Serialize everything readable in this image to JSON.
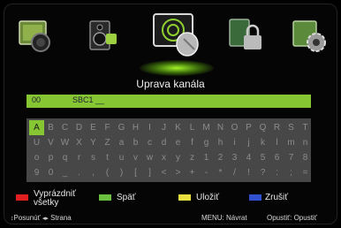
{
  "icons": [
    "picture-icon",
    "sound-icon",
    "channel-icon",
    "lock-icon",
    "setup-icon"
  ],
  "selected_icon": "channel-icon",
  "title": "Uprava kanála",
  "channel": {
    "number": "00",
    "name": "SBC1 __"
  },
  "keyboard": {
    "rows": [
      [
        "A",
        "B",
        "C",
        "D",
        "E",
        "F",
        "G",
        "H",
        "I",
        "J",
        "K",
        "L",
        "M",
        "N",
        "O",
        "P",
        "Q",
        "R",
        "S",
        "T"
      ],
      [
        "U",
        "V",
        "W",
        "X",
        "Y",
        "Z",
        "a",
        "b",
        "c",
        "d",
        "e",
        "f",
        "g",
        "h",
        "i",
        "j",
        "k",
        "l",
        "m",
        "n"
      ],
      [
        "o",
        "p",
        "q",
        "r",
        "s",
        "t",
        "u",
        "v",
        "w",
        "x",
        "y",
        "z",
        "1",
        "2",
        "3",
        "4",
        "5",
        "6",
        "7",
        "8"
      ],
      [
        "9",
        "0",
        "_",
        ".",
        ",",
        "(",
        ")",
        "[",
        "]",
        "<",
        ">",
        "+",
        "-",
        "*",
        "/",
        "!",
        "?",
        ":",
        ";",
        "="
      ]
    ],
    "active_key": "A"
  },
  "legend": {
    "clear": "Vyprázdniť všetky",
    "back": "Späť",
    "save": "Uložiť",
    "cancel": "Zrušiť"
  },
  "hints": {
    "move": "Posunúť",
    "page": "Strana",
    "menu": "MENU: Návrat",
    "exit": "Opustiť: Opustiť"
  },
  "colors": {
    "accent": "#86c633",
    "red": "#e02020",
    "green": "#6cc040",
    "yellow": "#e8e040",
    "blue": "#3050d0"
  }
}
